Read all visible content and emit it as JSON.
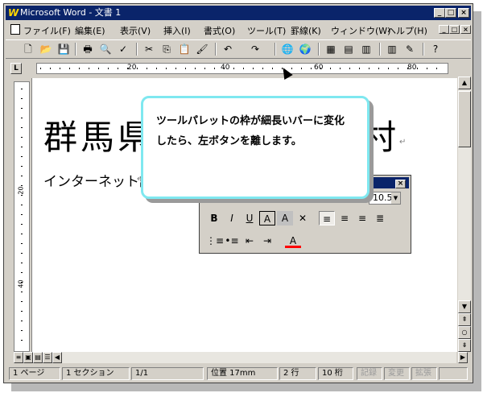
{
  "window": {
    "title": "Microsoft Word - 文書 1",
    "logo": "W",
    "controls": [
      "_",
      "□",
      "×"
    ]
  },
  "menubar": {
    "items": [
      "ファイル(F)",
      "編集(E)",
      "表示(V)",
      "挿入(I)",
      "書式(O)",
      "ツール(T)",
      "罫線(K)",
      "ウィンドウ(W)",
      "ヘルプ(H)"
    ],
    "mdi_controls": [
      "_",
      "□",
      "×"
    ]
  },
  "toolbar": {
    "buttons": [
      {
        "name": "new-doc-icon",
        "glyph": "🗋"
      },
      {
        "name": "open-icon",
        "glyph": "📂"
      },
      {
        "name": "save-icon",
        "glyph": "💾"
      },
      {
        "name": "print-icon",
        "glyph": "🖶"
      },
      {
        "name": "print-preview-icon",
        "glyph": "🔍"
      },
      {
        "name": "spellcheck-icon",
        "glyph": "✓"
      },
      {
        "name": "cut-icon",
        "glyph": "✂"
      },
      {
        "name": "copy-icon",
        "glyph": "⎘"
      },
      {
        "name": "paste-icon",
        "glyph": "📋"
      },
      {
        "name": "format-painter-icon",
        "glyph": "🖌"
      },
      {
        "name": "undo-icon",
        "glyph": "↶"
      },
      {
        "name": "redo-icon",
        "glyph": "↷"
      },
      {
        "name": "hyperlink-icon",
        "glyph": "🌐"
      },
      {
        "name": "web-toolbar-icon",
        "glyph": "🌍"
      },
      {
        "name": "tables-borders-icon",
        "glyph": "▦"
      },
      {
        "name": "insert-table-icon",
        "glyph": "▤"
      },
      {
        "name": "insert-excel-icon",
        "glyph": "▥"
      },
      {
        "name": "columns-icon",
        "glyph": "▥"
      },
      {
        "name": "drawing-icon",
        "glyph": "✎"
      },
      {
        "name": "help-icon",
        "glyph": "?"
      }
    ]
  },
  "ruler": {
    "corner": "L",
    "labels": [
      "20",
      "40",
      "60",
      "80"
    ],
    "vlabels": [
      "20",
      "40"
    ]
  },
  "document": {
    "title_text": "群馬県",
    "title_end": "村",
    "subtitle": "インターネット講座",
    "para_mark": "↵"
  },
  "palette": {
    "size_value": "10.5",
    "row1": [
      "B",
      "I",
      "U",
      "A",
      "A",
      "✕",
      "≡",
      "≡",
      "≡",
      "≣"
    ],
    "row2": [
      "⋮≡",
      "•≡",
      "⇤",
      "⇥",
      "A"
    ]
  },
  "callout": {
    "text_line1": "ツールパレットの枠が細長いバーに変化",
    "text_line2": "したら、左ボタンを離します。"
  },
  "statusbar": {
    "page": "1 ページ",
    "section": "1 セクション",
    "pages": "1/1",
    "position": "位置 17mm",
    "line": "2 行",
    "column": "10 桁",
    "rec": "記録",
    "trk": "変更",
    "ext": "拡張"
  },
  "colors": {
    "titlebar": "#0a246a",
    "callout_border": "#7fe8f0",
    "font_color_red": "#ff0000"
  }
}
